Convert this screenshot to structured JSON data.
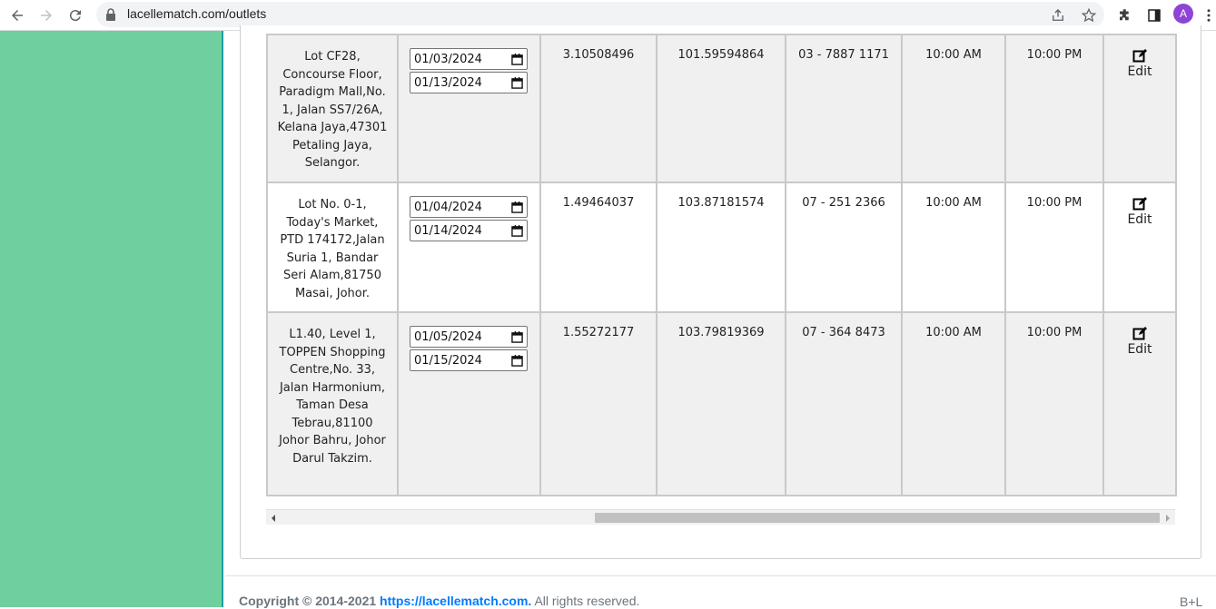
{
  "browser": {
    "url": "lacellematch.com/outlets",
    "profile_initial": "A",
    "icons": [
      "back-arrow-icon",
      "forward-arrow-icon",
      "reload-icon",
      "lock-icon",
      "share-icon",
      "star-icon",
      "extensions-icon",
      "sidepanel-icon",
      "menu-icon"
    ]
  },
  "table": {
    "rows": [
      {
        "address": "Lot CF28, Concourse Floor, Paradigm Mall,No. 1, Jalan SS7/26A, Kelana Jaya,47301 Petaling Jaya, Selangor.",
        "start_date": "01/03/2024",
        "end_date": "01/13/2024",
        "latitude": "3.10508496",
        "longitude": "101.59594864",
        "phone": "03 - 7887 1171",
        "open_time": "10:00 AM",
        "close_time": "10:00 PM",
        "edit_label": "Edit"
      },
      {
        "address": "Lot No. 0-1, Today's Market, PTD 174172,Jalan Suria 1, Bandar Seri Alam,81750 Masai, Johor.",
        "start_date": "01/04/2024",
        "end_date": "01/14/2024",
        "latitude": "1.49464037",
        "longitude": "103.87181574",
        "phone": "07 - 251 2366",
        "open_time": "10:00 AM",
        "close_time": "10:00 PM",
        "edit_label": "Edit"
      },
      {
        "address": "L1.40, Level 1, TOPPEN Shopping Centre,No. 33, Jalan Harmonium, Taman Desa Tebrau,81100 Johor Bahru, Johor Darul Takzim.",
        "start_date": "01/05/2024",
        "end_date": "01/15/2024",
        "latitude": "1.55272177",
        "longitude": "103.79819369",
        "phone": "07 - 364 8473",
        "open_time": "10:00 AM",
        "close_time": "10:00 PM",
        "edit_label": "Edit"
      }
    ]
  },
  "footer": {
    "copyright": "Copyright © 2014-2021 ",
    "link": "https://lacellematch.com.",
    "rights": " All rights reserved.",
    "right_text": "B+L"
  },
  "colors": {
    "sidebar": "#6fcf9e",
    "sidebar_border": "#1aa0a0",
    "row_gray": "#f0f0f0",
    "link": "#007bff",
    "profile": "#8e44d6"
  }
}
